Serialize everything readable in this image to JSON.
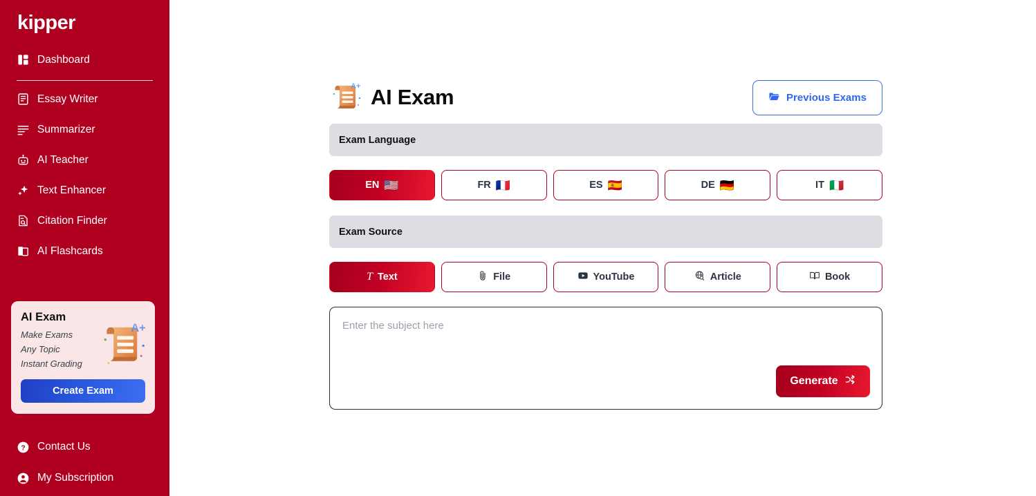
{
  "brand": {
    "name": "kipper"
  },
  "sidebar": {
    "dashboard": {
      "label": "Dashboard",
      "icon": "layout-dashboard-icon"
    },
    "items": [
      {
        "label": "Essay Writer",
        "icon": "document-text-icon"
      },
      {
        "label": "Summarizer",
        "icon": "lines-icon"
      },
      {
        "label": "AI Teacher",
        "icon": "robot-icon"
      },
      {
        "label": "Text Enhancer",
        "icon": "sparkles-icon"
      },
      {
        "label": "Citation Finder",
        "icon": "document-search-icon"
      },
      {
        "label": "AI Flashcards",
        "icon": "cards-icon"
      }
    ],
    "promo": {
      "title": "AI Exam",
      "lines": [
        "Make Exams",
        "Any Topic",
        "Instant Grading"
      ],
      "button_label": "Create Exam",
      "art": "exam-scroll-illustration",
      "bg_color": "#fbe6e7",
      "button_color": "#2b5ce0"
    },
    "bottom": [
      {
        "label": "Contact Us",
        "icon": "question-circle-icon"
      },
      {
        "label": "My Subscription",
        "icon": "user-circle-icon"
      }
    ],
    "bg_color": "#b00020"
  },
  "header": {
    "title": "AI Exam",
    "icon": "exam-scroll-illustration",
    "previous_exams": {
      "label": "Previous Exams",
      "icon": "folder-icon",
      "color": "#2f68f0"
    }
  },
  "exam_language": {
    "section_label": "Exam Language",
    "selected": "EN",
    "options": [
      {
        "code": "EN",
        "flag": "🇺🇸",
        "selected": true
      },
      {
        "code": "FR",
        "flag": "🇫🇷",
        "selected": false
      },
      {
        "code": "ES",
        "flag": "🇪🇸",
        "selected": false
      },
      {
        "code": "DE",
        "flag": "🇩🇪",
        "selected": false
      },
      {
        "code": "IT",
        "flag": "🇮🇹",
        "selected": false
      }
    ]
  },
  "exam_source": {
    "section_label": "Exam Source",
    "selected": "Text",
    "options": [
      {
        "label": "Text",
        "icon": "italic-t-icon",
        "selected": true
      },
      {
        "label": "File",
        "icon": "paperclip-icon",
        "selected": false
      },
      {
        "label": "YouTube",
        "icon": "youtube-icon",
        "selected": false
      },
      {
        "label": "Article",
        "icon": "globe-search-icon",
        "selected": false
      },
      {
        "label": "Book",
        "icon": "book-open-icon",
        "selected": false
      }
    ]
  },
  "editor": {
    "placeholder": "Enter the subject here",
    "value": "",
    "generate": {
      "label": "Generate",
      "icon": "shuffle-icon"
    }
  },
  "accent": {
    "red": "#b00020",
    "red_bright": "#e8192e",
    "blue": "#2f68f0",
    "gray_bar": "#dcdee3"
  }
}
